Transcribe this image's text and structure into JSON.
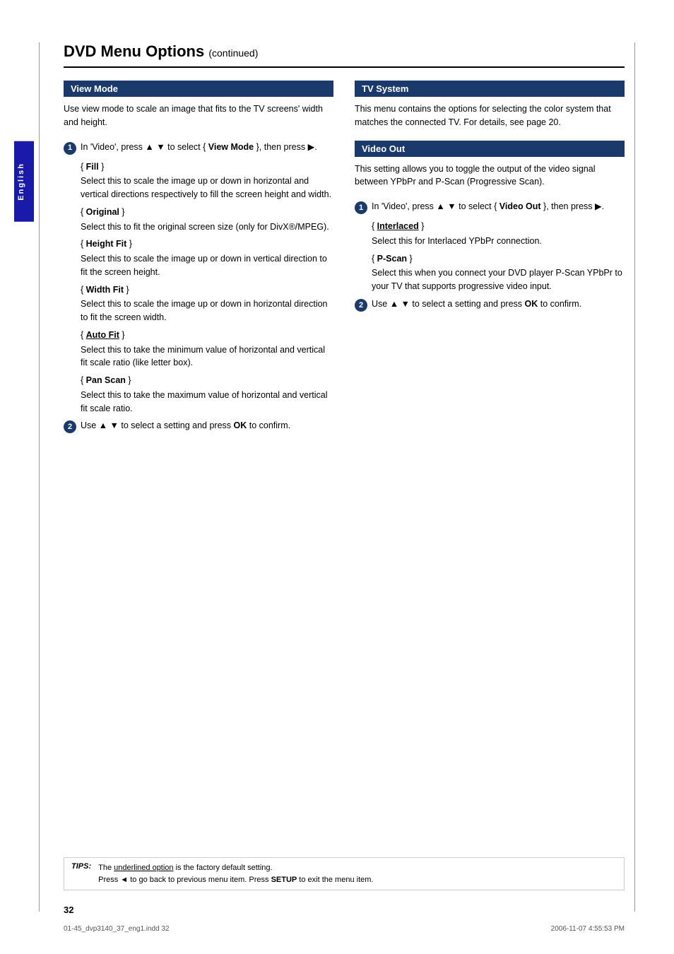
{
  "page": {
    "title": "DVD Menu Options",
    "continued_label": "(continued)",
    "page_number": "32",
    "footer_file": "01-45_dvp3140_37_eng1.indd  32",
    "footer_date": "2006-11-07   4:55:53 PM"
  },
  "sidebar": {
    "label": "English"
  },
  "tips": {
    "label": "TIPS:",
    "line1": "The underlined option is the factory default setting.",
    "line2": "Press ◄ to go back to previous menu item. Press SETUP to exit the menu item."
  },
  "left_column": {
    "section_title": "View Mode",
    "intro": "Use view mode to scale an image that fits to the TV screens' width and height.",
    "step1": {
      "num": "1",
      "text_prefix": "In 'Video', press ▲ ▼ to select { ",
      "bold": "View Mode",
      "text_suffix": " }, then press ▶."
    },
    "options": [
      {
        "title": "{ Fill }",
        "title_bold": "Fill",
        "desc": "Select this to scale the image up or down in horizontal and vertical directions respectively to fill the screen height and width."
      },
      {
        "title": "{ Original }",
        "title_bold": "Original",
        "desc": "Select this to fit the original screen size (only for DivX®/MPEG)."
      },
      {
        "title": "{ Height Fit }",
        "title_bold": "Height Fit",
        "desc": "Select this to scale the image up or down in vertical direction to fit the screen height."
      },
      {
        "title": "{ Width Fit }",
        "title_bold": "Width Fit",
        "desc": "Select this to scale the image up or down in horizontal direction to fit the screen width."
      },
      {
        "title": "{ Auto Fit }",
        "title_bold": "Auto Fit",
        "underline": true,
        "desc": "Select this to take the minimum value of horizontal and vertical fit scale ratio (like letter box)."
      },
      {
        "title": "{ Pan Scan }",
        "title_bold": "Pan Scan",
        "desc": "Select this to take the maximum value of horizontal and vertical fit scale ratio."
      }
    ],
    "step2": {
      "num": "2",
      "text": "Use ▲ ▼ to select a setting and press ",
      "bold": "OK",
      "text_suffix": " to confirm."
    }
  },
  "right_column": {
    "tv_system": {
      "section_title": "TV System",
      "desc": "This menu contains the options for selecting the color system that matches the connected TV. For details, see page 20."
    },
    "video_out": {
      "section_title": "Video Out",
      "intro": "This setting allows you to toggle the output of the video signal between YPbPr and P-Scan (Progressive Scan).",
      "step1": {
        "num": "1",
        "text_prefix": "In 'Video', press ▲ ▼ to select { ",
        "bold": "Video Out",
        "text_suffix": " }, then press ▶."
      },
      "options": [
        {
          "title": "{ Interlaced }",
          "title_bold": "Interlaced",
          "underline": true,
          "desc": "Select this for Interlaced YPbPr connection."
        },
        {
          "title": "{ P-Scan }",
          "title_bold": "P-Scan",
          "desc": "Select this when you connect your DVD player P-Scan YPbPr to your TV that supports progressive video input."
        }
      ],
      "step2": {
        "num": "2",
        "text": "Use ▲ ▼ to select a setting and press ",
        "bold": "OK",
        "text_suffix": " to confirm."
      }
    }
  }
}
